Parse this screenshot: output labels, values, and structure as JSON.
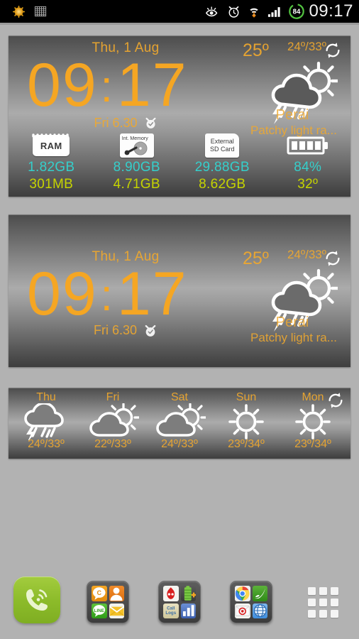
{
  "statusbar": {
    "time": "09:17",
    "battery_level": "84",
    "left_icons": [
      "brightness-sun-icon",
      "grid-app-icon"
    ],
    "right_icons": [
      "smart-stay-eye-icon",
      "alarm-clock-icon",
      "wifi-icon",
      "signal-bars-icon",
      "battery-circle-icon"
    ]
  },
  "widget_top": {
    "date": "Thu, 1 Aug",
    "time_hours": "09",
    "time_colon": ":",
    "time_minutes": "17",
    "alarm": "Fri 6.30",
    "alarm_icon": "alarm-clock-icon",
    "current_temp": "25º",
    "high_low": "24º/33º",
    "location": "Perai",
    "condition": "Patchy light ra...",
    "weather_icon": "rain-sun-cloud-icon",
    "refresh_icon": "refresh-icon",
    "system": [
      {
        "name": "RAM",
        "icon": "ram-chip-icon",
        "chip_label": "RAM",
        "free": "1.82GB",
        "used": "301MB"
      },
      {
        "name": "Int. Memory",
        "icon": "internal-disk-icon",
        "chip_label": "Int. Memory",
        "free": "8.90GB",
        "used": "4.71GB"
      },
      {
        "name": "External SD",
        "icon": "sd-card-icon",
        "chip_label": "External\nSD Card",
        "free": "29.88GB",
        "used": "8.62GB"
      },
      {
        "name": "Battery",
        "icon": "battery-icon",
        "chip_label": "",
        "free": "84%",
        "used": "32º"
      }
    ]
  },
  "widget_clock": {
    "date": "Thu, 1 Aug",
    "time_hours": "09",
    "time_colon": ":",
    "time_minutes": "17",
    "alarm": "Fri 6.30",
    "alarm_icon": "alarm-clock-icon",
    "current_temp": "25º",
    "high_low": "24º/33º",
    "location": "Perai",
    "condition": "Patchy light ra...",
    "weather_icon": "rain-sun-cloud-icon",
    "refresh_icon": "refresh-icon"
  },
  "widget_forecast": {
    "refresh_icon": "refresh-icon",
    "days": [
      {
        "name": "Thu",
        "icon": "rain-cloud-icon",
        "temps": "24º/33º"
      },
      {
        "name": "Fri",
        "icon": "cloud-sun-icon",
        "temps": "22º/33º"
      },
      {
        "name": "Sat",
        "icon": "cloud-sun-icon",
        "temps": "24º/33º"
      },
      {
        "name": "Sun",
        "icon": "sun-icon",
        "temps": "23º/34º"
      },
      {
        "name": "Mon",
        "icon": "sun-icon",
        "temps": "23º/34º"
      }
    ]
  },
  "dock": {
    "items": [
      {
        "name": "phone",
        "type": "app",
        "icon": "phone-handset-icon"
      },
      {
        "name": "communication-folder",
        "type": "folder",
        "apps": [
          "kakaotalk-icon",
          "contacts-icon",
          "line-icon",
          "email-icon"
        ]
      },
      {
        "name": "tools-folder",
        "type": "folder",
        "apps": [
          "antutu-icon",
          "battery-plus-icon",
          "call-logs-icon",
          "stats-bar-chart-icon"
        ]
      },
      {
        "name": "browsers-folder",
        "type": "folder",
        "apps": [
          "chrome-icon",
          "dolphin-browser-icon",
          "mail-target-icon",
          "web-globe-icon"
        ]
      },
      {
        "name": "app-drawer",
        "type": "drawer",
        "icon": "apps-grid-icon"
      }
    ]
  },
  "colors": {
    "amber": "#f5a623",
    "cyan": "#35cfcb",
    "lime": "#c6d400",
    "wallpaper": "#b2b2b2",
    "statusbar_bg": "#000000",
    "battery_green": "#5ec24a"
  }
}
